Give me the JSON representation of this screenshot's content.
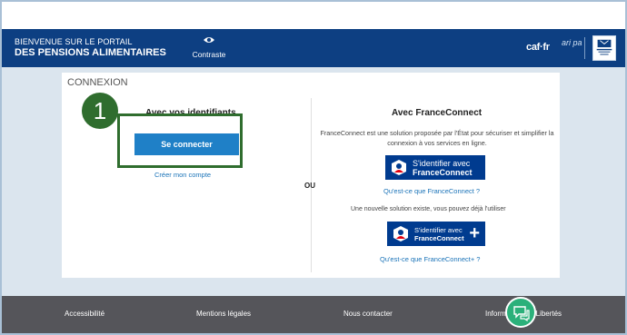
{
  "header": {
    "portal_line1": "BIENVENUE SUR LE PORTAIL",
    "portal_line2": "DES PENSIONS ALIMENTAIRES",
    "contrast_label": "Contraste",
    "caf_logo": "caf·fr",
    "aripa_logo": "ari pa"
  },
  "login": {
    "section_title": "CONNEXION",
    "step_badge": "1",
    "credentials": {
      "title": "Avec vos identifiants",
      "connect_button": "Se connecter",
      "create_account_link": "Créer mon compte"
    },
    "separator": "OU",
    "franceconnect": {
      "title": "Avec FranceConnect",
      "description": "FranceConnect est une solution proposée par l'État pour sécuriser et simplifier la connexion à vos services en ligne.",
      "button_line1": "S'identifier avec",
      "button_line2": "FranceConnect",
      "what_is_link": "Qu'est-ce que FranceConnect ?",
      "new_solution_note": "Une nouvelle solution existe, vous pouvez déjà l'utiliser",
      "plus_button_line1": "S'identifier avec",
      "plus_button_line2": "FranceConnect",
      "plus_symbol": "+",
      "what_is_plus_link": "Qu'est-ce que FranceConnect+ ?"
    }
  },
  "footer": {
    "links": [
      "Accessibilité",
      "Mentions légales",
      "Nous contacter",
      "Informatique et Libertés"
    ]
  },
  "colors": {
    "header_bg": "#0d3f82",
    "primary_button": "#1f80c7",
    "franceconnect_blue": "#003b8f",
    "highlight_green": "#2f6d2e",
    "footer_bg": "#55555a",
    "chat_green": "#2bb07a"
  },
  "icons": {
    "contrast": "eye-icon",
    "chat": "chat-bubble-icon",
    "franceconnect": "franceconnect-logo-icon",
    "government": "marianne-logo-icon"
  }
}
